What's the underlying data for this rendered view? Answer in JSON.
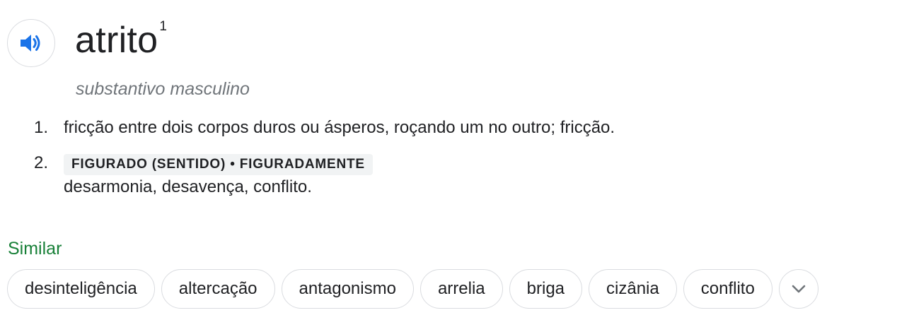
{
  "entry": {
    "headword": "atrito",
    "homograph": "1",
    "part_of_speech": "substantivo masculino",
    "icons": {
      "speaker": "speaker-icon",
      "expand": "chevron-down-icon"
    },
    "colors": {
      "speaker": "#1a73e8",
      "similar": "#188038",
      "muted": "#70757a"
    }
  },
  "senses": [
    {
      "number": "1.",
      "definition": "fricção entre dois corpos duros ou ásperos, roçando um no outro; fricção."
    },
    {
      "number": "2.",
      "label": "FIGURADO (SENTIDO) • FIGURADAMENTE",
      "definition": "desarmonia, desavença, conflito."
    }
  ],
  "similar": {
    "title": "Similar",
    "words": [
      "desinteligência",
      "altercação",
      "antagonismo",
      "arrelia",
      "briga",
      "cizânia",
      "conflito"
    ]
  }
}
